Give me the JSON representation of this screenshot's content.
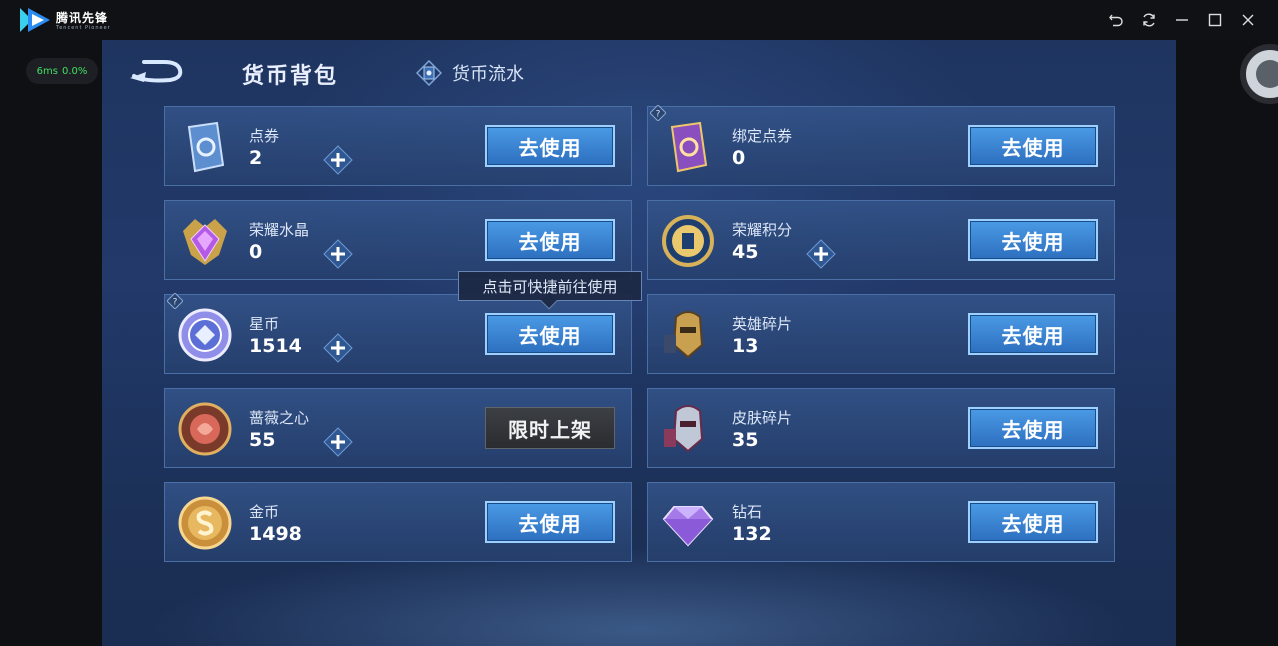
{
  "app": {
    "name": "腾讯先锋",
    "subtitle": "Tencent Pioneer",
    "window_controls": [
      "undo-icon",
      "refresh-icon",
      "minimize-icon",
      "maximize-icon",
      "close-icon"
    ]
  },
  "overlay": {
    "latency": "6ms",
    "loss": "0.0%"
  },
  "header": {
    "title": "货币背包",
    "flow_tab": "货币流水"
  },
  "tooltip": "点击可快捷前往使用",
  "cards": [
    {
      "name": "点券",
      "value": "2",
      "button": "去使用",
      "plus": true,
      "help": false,
      "icon": "voucher-icon"
    },
    {
      "name": "绑定点券",
      "value": "0",
      "button": "去使用",
      "plus": false,
      "help": true,
      "icon": "bound-voucher-icon"
    },
    {
      "name": "荣耀水晶",
      "value": "0",
      "button": "去使用",
      "plus": true,
      "help": false,
      "icon": "glory-crystal-icon"
    },
    {
      "name": "荣耀积分",
      "value": "45",
      "button": "去使用",
      "plus": true,
      "help": false,
      "icon": "glory-points-icon"
    },
    {
      "name": "星币",
      "value": "1514",
      "button": "去使用",
      "plus": true,
      "help": true,
      "icon": "star-coin-icon"
    },
    {
      "name": "英雄碎片",
      "value": "13",
      "button": "去使用",
      "plus": false,
      "help": false,
      "icon": "hero-fragment-icon"
    },
    {
      "name": "蔷薇之心",
      "value": "55",
      "button": "限时上架",
      "plus": true,
      "help": false,
      "icon": "rose-heart-icon"
    },
    {
      "name": "皮肤碎片",
      "value": "35",
      "button": "去使用",
      "plus": false,
      "help": false,
      "icon": "skin-fragment-icon"
    },
    {
      "name": "金币",
      "value": "1498",
      "button": "去使用",
      "plus": false,
      "help": false,
      "icon": "gold-coin-icon"
    },
    {
      "name": "钻石",
      "value": "132",
      "button": "去使用",
      "plus": false,
      "help": false,
      "icon": "diamond-icon"
    }
  ],
  "colors": {
    "button_blue": "#3a86d6",
    "panel": "#2e4c80",
    "background": "#1f3560"
  }
}
